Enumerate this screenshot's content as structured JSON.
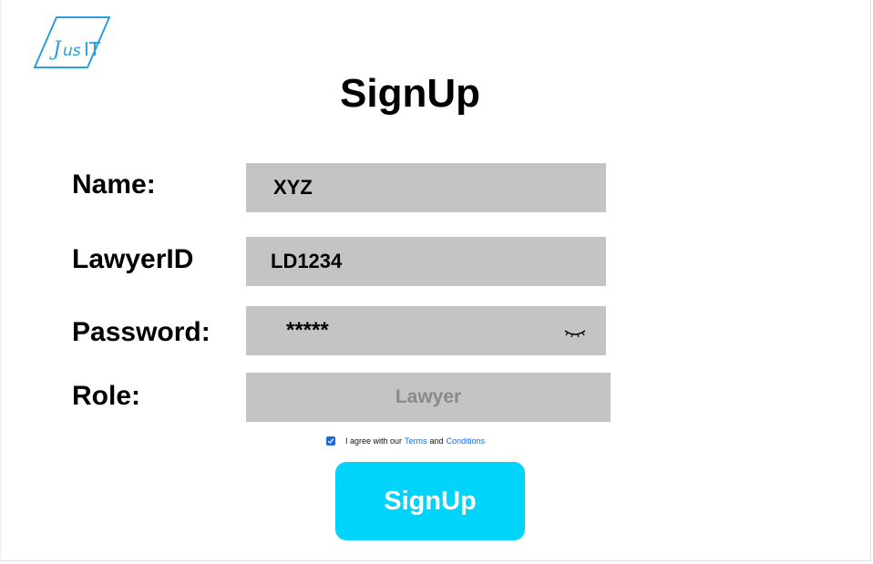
{
  "brand": {
    "logo_text": "JusIT",
    "logo_color": "#2ba0d8"
  },
  "page": {
    "title": "SignUp"
  },
  "form": {
    "name": {
      "label": "Name:",
      "value": "XYZ"
    },
    "lawyer_id": {
      "label": "LawyerID",
      "value": "LD1234"
    },
    "password": {
      "label": "Password:",
      "value": "*****",
      "toggle_icon": "eye-closed-icon"
    },
    "role": {
      "label": "Role:",
      "value": "Lawyer"
    },
    "field_bg": "#c4c4c4"
  },
  "agreement": {
    "checked": true,
    "prefix": "I agree with our",
    "terms": "Terms",
    "and": "and",
    "conditions": "Conditions",
    "link_color": "#1d67d6"
  },
  "submit": {
    "label": "SignUp",
    "bg_color": "#00d4fa"
  }
}
